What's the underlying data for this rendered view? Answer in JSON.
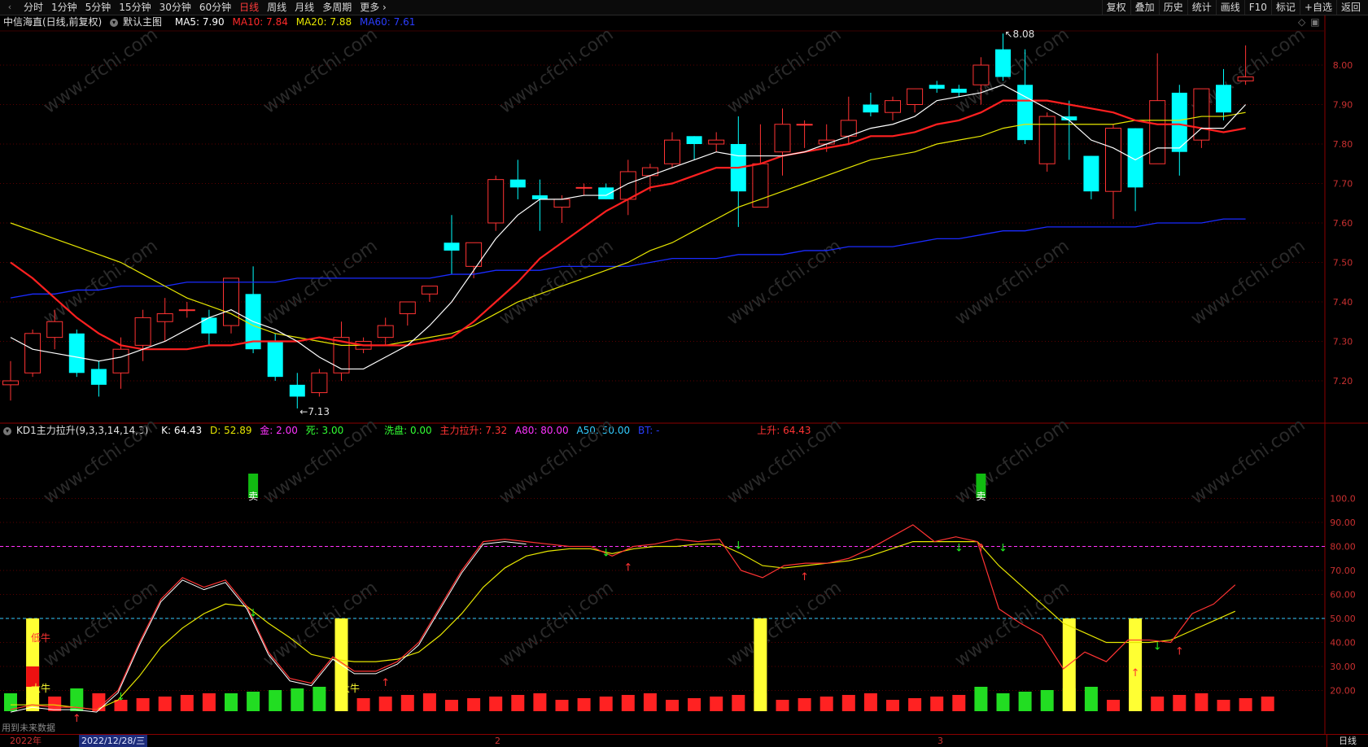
{
  "toolbar": {
    "back_icon": "‹",
    "periods": [
      "分时",
      "1分钟",
      "5分钟",
      "15分钟",
      "30分钟",
      "60分钟",
      "日线",
      "周线",
      "月线",
      "多周期",
      "更多 ›"
    ],
    "active_period": "日线",
    "right_buttons": [
      "复权",
      "叠加",
      "历史",
      "统计",
      "画线",
      "F10",
      "标记",
      "+自选",
      "返回"
    ]
  },
  "main_legend": {
    "stock": "中信海直(日线,前复权)",
    "template": "默认主图",
    "ma5": "MA5: 7.90",
    "ma10": "MA10: 7.84",
    "ma20": "MA20: 7.88",
    "ma60": "MA60: 7.61"
  },
  "sub_legend": {
    "indicator": "KD1主力拉升(9,3,3,14,14,3)",
    "k": "K: 64.43",
    "d": "D: 52.89",
    "gold": "金: 2.00",
    "dead": "死: 3.00",
    "wash": "洗盘: 0.00",
    "pull": "主力拉升: 7.32",
    "a80": "A80: 80.00",
    "a50": "A50: 50.00",
    "bt": "BT: -",
    "rise": "上升: 64.43"
  },
  "status": {
    "future_data": "用到未来数据"
  },
  "time_axis": {
    "year": "2022年",
    "cursor_date": "2022/12/28/三",
    "month2": "2",
    "month3": "3",
    "period_button": "日线"
  },
  "price_axis": {
    "ticks": [
      "8.00",
      "7.90",
      "7.80",
      "7.70",
      "7.60",
      "7.50",
      "7.40",
      "7.30",
      "7.20"
    ]
  },
  "sub_axis": {
    "ticks": [
      "100.0",
      "90.00",
      "80.00",
      "70.00",
      "60.00",
      "50.00",
      "40.00",
      "30.00",
      "20.00"
    ]
  },
  "annotations": {
    "high": "8.08",
    "low": "7.13",
    "sell1": "卖",
    "sell2": "卖",
    "buy1": "低牛",
    "buy2": "大牛",
    "buy3": "大牛"
  },
  "watermark": "www.cfchi.com",
  "colors": {
    "up": "#ff3333",
    "down": "#00ffff",
    "ma5": "#ffffff",
    "ma10": "#ff2020",
    "ma20": "#e6e600",
    "ma60": "#1a2bff",
    "background": "#000000"
  },
  "chart_data": {
    "type": "candlestick",
    "title": "中信海直(日线,前复权)",
    "ylim": [
      7.13,
      8.08
    ],
    "candles": [
      {
        "o": 7.19,
        "h": 7.25,
        "l": 7.15,
        "c": 7.2
      },
      {
        "o": 7.22,
        "h": 7.33,
        "l": 7.21,
        "c": 7.32
      },
      {
        "o": 7.31,
        "h": 7.38,
        "l": 7.28,
        "c": 7.35
      },
      {
        "o": 7.32,
        "h": 7.33,
        "l": 7.21,
        "c": 7.22
      },
      {
        "o": 7.23,
        "h": 7.25,
        "l": 7.16,
        "c": 7.19
      },
      {
        "o": 7.22,
        "h": 7.31,
        "l": 7.18,
        "c": 7.28
      },
      {
        "o": 7.29,
        "h": 7.38,
        "l": 7.25,
        "c": 7.36
      },
      {
        "o": 7.35,
        "h": 7.41,
        "l": 7.3,
        "c": 7.37
      },
      {
        "o": 7.38,
        "h": 7.4,
        "l": 7.36,
        "c": 7.38
      },
      {
        "o": 7.36,
        "h": 7.38,
        "l": 7.29,
        "c": 7.32
      },
      {
        "o": 7.34,
        "h": 7.46,
        "l": 7.32,
        "c": 7.46
      },
      {
        "o": 7.42,
        "h": 7.49,
        "l": 7.27,
        "c": 7.28
      },
      {
        "o": 7.3,
        "h": 7.32,
        "l": 7.2,
        "c": 7.21
      },
      {
        "o": 7.19,
        "h": 7.22,
        "l": 7.13,
        "c": 7.16
      },
      {
        "o": 7.17,
        "h": 7.23,
        "l": 7.16,
        "c": 7.22
      },
      {
        "o": 7.22,
        "h": 7.35,
        "l": 7.2,
        "c": 7.31
      },
      {
        "o": 7.28,
        "h": 7.31,
        "l": 7.27,
        "c": 7.3
      },
      {
        "o": 7.31,
        "h": 7.36,
        "l": 7.29,
        "c": 7.34
      },
      {
        "o": 7.37,
        "h": 7.4,
        "l": 7.34,
        "c": 7.4
      },
      {
        "o": 7.42,
        "h": 7.44,
        "l": 7.4,
        "c": 7.44
      },
      {
        "o": 7.55,
        "h": 7.62,
        "l": 7.47,
        "c": 7.53
      },
      {
        "o": 7.49,
        "h": 7.55,
        "l": 7.46,
        "c": 7.55
      },
      {
        "o": 7.6,
        "h": 7.72,
        "l": 7.58,
        "c": 7.71
      },
      {
        "o": 7.71,
        "h": 7.76,
        "l": 7.66,
        "c": 7.69
      },
      {
        "o": 7.67,
        "h": 7.71,
        "l": 7.58,
        "c": 7.66
      },
      {
        "o": 7.64,
        "h": 7.67,
        "l": 7.6,
        "c": 7.66
      },
      {
        "o": 7.69,
        "h": 7.7,
        "l": 7.67,
        "c": 7.69
      },
      {
        "o": 7.69,
        "h": 7.7,
        "l": 7.66,
        "c": 7.66
      },
      {
        "o": 7.66,
        "h": 7.76,
        "l": 7.62,
        "c": 7.73
      },
      {
        "o": 7.72,
        "h": 7.75,
        "l": 7.68,
        "c": 7.74
      },
      {
        "o": 7.75,
        "h": 7.83,
        "l": 7.74,
        "c": 7.81
      },
      {
        "o": 7.82,
        "h": 7.82,
        "l": 7.76,
        "c": 7.8
      },
      {
        "o": 7.8,
        "h": 7.83,
        "l": 7.78,
        "c": 7.81
      },
      {
        "o": 7.8,
        "h": 7.87,
        "l": 7.59,
        "c": 7.68
      },
      {
        "o": 7.64,
        "h": 7.85,
        "l": 7.64,
        "c": 7.75
      },
      {
        "o": 7.78,
        "h": 7.89,
        "l": 7.72,
        "c": 7.85
      },
      {
        "o": 7.85,
        "h": 7.86,
        "l": 7.79,
        "c": 7.85
      },
      {
        "o": 7.8,
        "h": 7.85,
        "l": 7.78,
        "c": 7.81
      },
      {
        "o": 7.82,
        "h": 7.92,
        "l": 7.8,
        "c": 7.86
      },
      {
        "o": 7.9,
        "h": 7.93,
        "l": 7.87,
        "c": 7.88
      },
      {
        "o": 7.88,
        "h": 7.92,
        "l": 7.86,
        "c": 7.91
      },
      {
        "o": 7.9,
        "h": 7.94,
        "l": 7.88,
        "c": 7.94
      },
      {
        "o": 7.95,
        "h": 7.96,
        "l": 7.93,
        "c": 7.94
      },
      {
        "o": 7.94,
        "h": 7.95,
        "l": 7.92,
        "c": 7.93
      },
      {
        "o": 7.95,
        "h": 8.02,
        "l": 7.9,
        "c": 8.0
      },
      {
        "o": 8.04,
        "h": 8.08,
        "l": 7.96,
        "c": 7.97
      },
      {
        "o": 7.95,
        "h": 8.04,
        "l": 7.8,
        "c": 7.81
      },
      {
        "o": 7.75,
        "h": 7.88,
        "l": 7.73,
        "c": 7.87
      },
      {
        "o": 7.87,
        "h": 7.91,
        "l": 7.76,
        "c": 7.86
      },
      {
        "o": 7.77,
        "h": 7.77,
        "l": 7.66,
        "c": 7.68
      },
      {
        "o": 7.68,
        "h": 7.85,
        "l": 7.61,
        "c": 7.84
      },
      {
        "o": 7.84,
        "h": 7.84,
        "l": 7.63,
        "c": 7.69
      },
      {
        "o": 7.75,
        "h": 8.03,
        "l": 7.75,
        "c": 7.91
      },
      {
        "o": 7.93,
        "h": 7.95,
        "l": 7.72,
        "c": 7.78
      },
      {
        "o": 7.81,
        "h": 7.94,
        "l": 7.79,
        "c": 7.94
      },
      {
        "o": 7.95,
        "h": 7.99,
        "l": 7.86,
        "c": 7.88
      },
      {
        "o": 7.96,
        "h": 8.05,
        "l": 7.95,
        "c": 7.97
      }
    ],
    "ma5": [
      7.31,
      7.28,
      7.27,
      7.26,
      7.25,
      7.26,
      7.28,
      7.3,
      7.33,
      7.36,
      7.38,
      7.35,
      7.33,
      7.3,
      7.26,
      7.23,
      7.23,
      7.26,
      7.29,
      7.34,
      7.4,
      7.48,
      7.56,
      7.62,
      7.66,
      7.66,
      7.67,
      7.67,
      7.7,
      7.72,
      7.74,
      7.76,
      7.78,
      7.77,
      7.77,
      7.77,
      7.78,
      7.8,
      7.82,
      7.84,
      7.85,
      7.87,
      7.91,
      7.92,
      7.93,
      7.95,
      7.92,
      7.89,
      7.86,
      7.81,
      7.79,
      7.76,
      7.79,
      7.79,
      7.84,
      7.84,
      7.9
    ],
    "ma10": [
      7.5,
      7.46,
      7.41,
      7.36,
      7.32,
      7.29,
      7.28,
      7.28,
      7.28,
      7.29,
      7.29,
      7.3,
      7.3,
      7.3,
      7.31,
      7.3,
      7.29,
      7.29,
      7.29,
      7.3,
      7.31,
      7.35,
      7.4,
      7.45,
      7.51,
      7.55,
      7.59,
      7.63,
      7.66,
      7.69,
      7.7,
      7.72,
      7.74,
      7.74,
      7.75,
      7.77,
      7.78,
      7.79,
      7.8,
      7.82,
      7.82,
      7.83,
      7.85,
      7.86,
      7.88,
      7.91,
      7.91,
      7.91,
      7.9,
      7.89,
      7.88,
      7.86,
      7.85,
      7.85,
      7.84,
      7.83,
      7.84
    ],
    "ma20": [
      7.6,
      7.58,
      7.56,
      7.54,
      7.52,
      7.5,
      7.47,
      7.44,
      7.41,
      7.39,
      7.37,
      7.34,
      7.32,
      7.31,
      7.3,
      7.29,
      7.29,
      7.29,
      7.3,
      7.31,
      7.32,
      7.34,
      7.37,
      7.4,
      7.42,
      7.44,
      7.46,
      7.48,
      7.5,
      7.53,
      7.55,
      7.58,
      7.61,
      7.64,
      7.66,
      7.68,
      7.7,
      7.72,
      7.74,
      7.76,
      7.77,
      7.78,
      7.8,
      7.81,
      7.82,
      7.84,
      7.85,
      7.85,
      7.85,
      7.85,
      7.85,
      7.86,
      7.86,
      7.86,
      7.87,
      7.87,
      7.88
    ],
    "ma60": [
      7.41,
      7.42,
      7.42,
      7.43,
      7.43,
      7.44,
      7.44,
      7.44,
      7.45,
      7.45,
      7.45,
      7.45,
      7.45,
      7.46,
      7.46,
      7.46,
      7.46,
      7.46,
      7.46,
      7.46,
      7.47,
      7.47,
      7.48,
      7.48,
      7.48,
      7.49,
      7.49,
      7.49,
      7.49,
      7.5,
      7.51,
      7.51,
      7.51,
      7.52,
      7.52,
      7.52,
      7.53,
      7.53,
      7.54,
      7.54,
      7.54,
      7.55,
      7.56,
      7.56,
      7.57,
      7.58,
      7.58,
      7.59,
      7.59,
      7.59,
      7.59,
      7.59,
      7.6,
      7.6,
      7.6,
      7.61,
      7.61
    ],
    "kd": {
      "k": [
        12,
        14,
        13,
        13,
        12,
        20,
        40,
        58,
        67,
        63,
        66,
        55,
        36,
        25,
        23,
        34,
        28,
        28,
        32,
        40,
        55,
        70,
        82,
        83,
        82,
        81,
        80,
        80,
        76,
        80,
        81,
        83,
        82,
        83,
        70,
        67,
        72,
        73,
        73,
        75,
        79,
        84,
        89,
        82,
        84,
        82,
        54,
        48,
        43,
        29,
        36,
        32,
        41,
        41,
        40,
        52,
        56,
        64
      ],
      "d": [
        14,
        14,
        14,
        13,
        12,
        16,
        26,
        38,
        46,
        52,
        56,
        55,
        48,
        42,
        35,
        33,
        32,
        32,
        33,
        36,
        43,
        52,
        63,
        71,
        76,
        78,
        79,
        79,
        77,
        79,
        80,
        80,
        81,
        81,
        77,
        72,
        71,
        72,
        73,
        74,
        76,
        79,
        82,
        82,
        82,
        82,
        72,
        64,
        56,
        48,
        44,
        40,
        40,
        40,
        41,
        45,
        49,
        53
      ]
    }
  }
}
